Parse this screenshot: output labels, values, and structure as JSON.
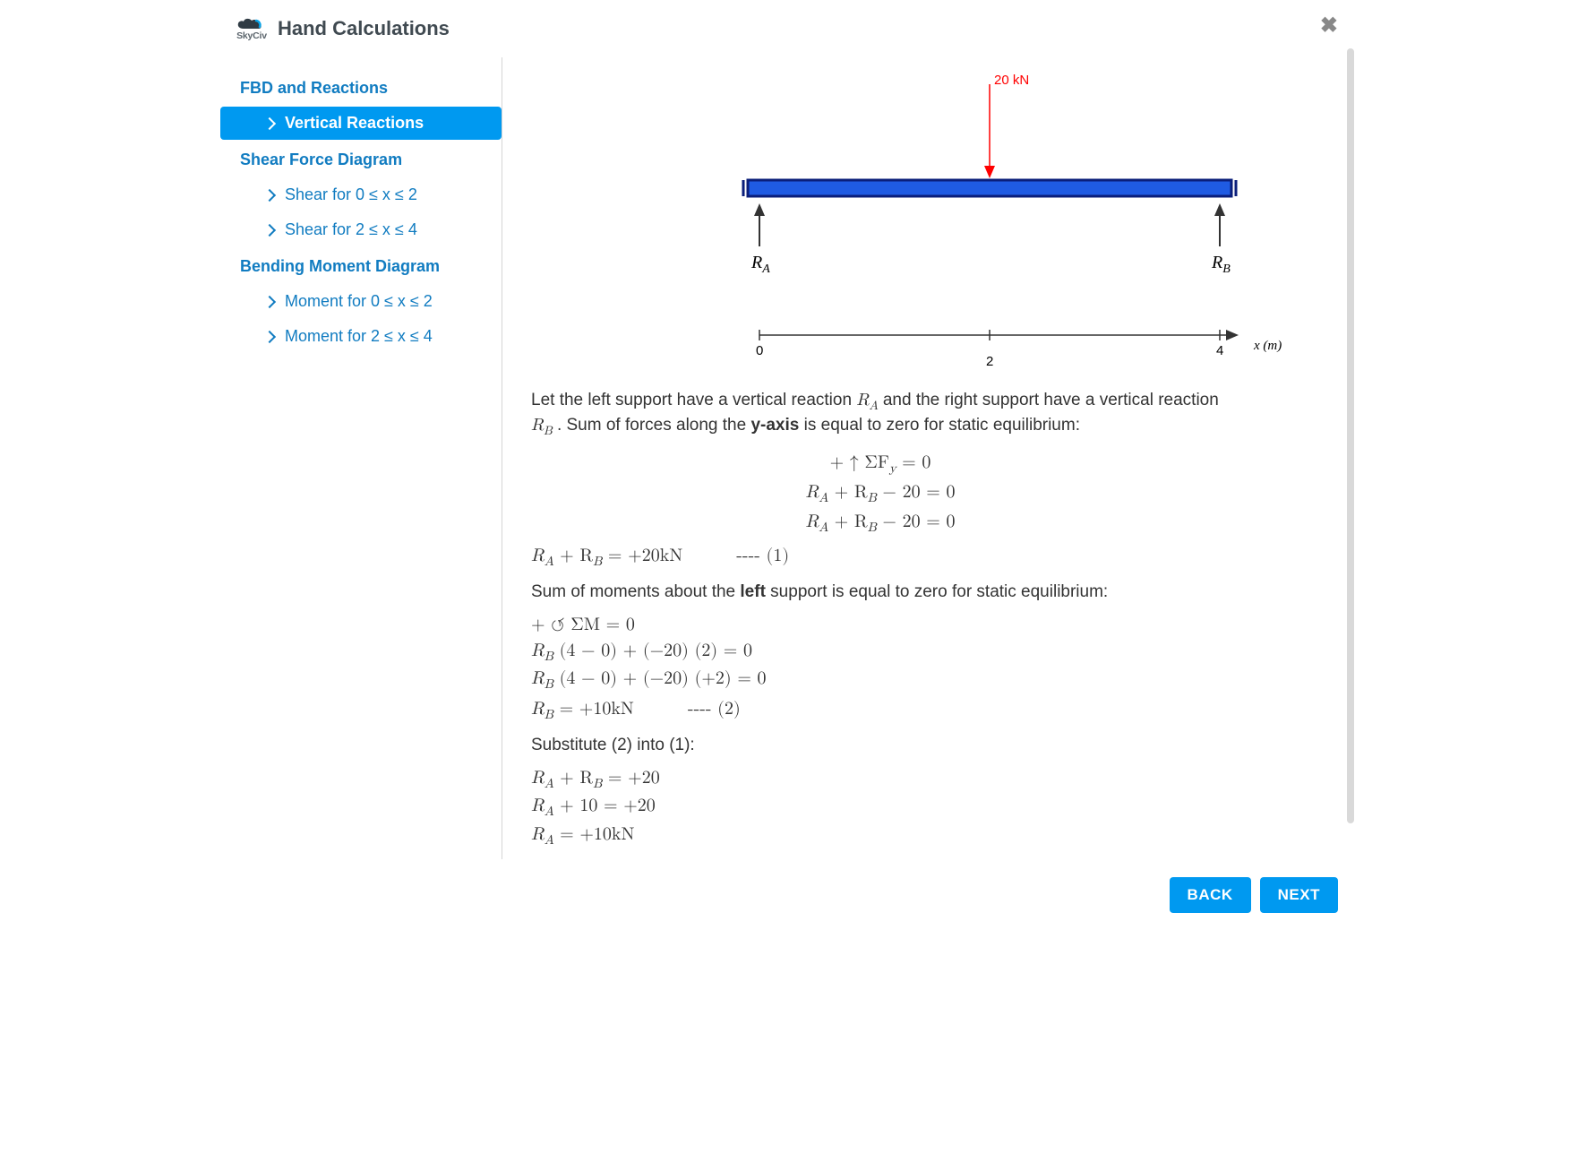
{
  "header": {
    "logo_text": "SkyCiv",
    "title": "Hand Calculations"
  },
  "sidebar": {
    "sections": [
      {
        "label": "FBD and Reactions",
        "items": [
          {
            "label": "Vertical Reactions",
            "active": true
          }
        ]
      },
      {
        "label": "Shear Force Diagram",
        "items": [
          {
            "label": "Shear for 0 ≤ x ≤ 2",
            "active": false
          },
          {
            "label": "Shear for 2 ≤ x ≤ 4",
            "active": false
          }
        ]
      },
      {
        "label": "Bending Moment Diagram",
        "items": [
          {
            "label": "Moment for 0 ≤ x ≤ 2",
            "active": false
          },
          {
            "label": "Moment for 2 ≤ x ≤ 4",
            "active": false
          }
        ]
      }
    ]
  },
  "diagram": {
    "load_label": "20 kN",
    "reaction_a": "R",
    "reaction_a_sub": "A",
    "reaction_b": "R",
    "reaction_b_sub": "B",
    "axis_label": "x (m)",
    "axis_values": [
      "0",
      "2",
      "4"
    ]
  },
  "content": {
    "para1_a": "Let the left support have a vertical reaction ",
    "para1_b": " and the right support have a vertical reaction ",
    "para1_c": " . Sum of forces along the ",
    "para1_d": "y-axis",
    "para1_e": " is equal to zero for static equilibrium:",
    "eq1": "+ ↑ ΣF",
    "eq1_sub": "y",
    "eq1_tail": " = 0",
    "eq2_a": "R",
    "eq2_b": " + R",
    "eq2_c": " − 20 = 0",
    "eq3_a": "R",
    "eq3_b": " + R",
    "eq3_c": " − 20 = 0",
    "eq4_a": "R",
    "eq4_b": " + R",
    "eq4_c": " = +20kN",
    "eq4_label": "---- (1)",
    "para2_a": "Sum of moments about the ",
    "para2_b": "left",
    "para2_c": " support is equal to zero for static equilibrium:",
    "eq5": "+ ↺ ΣM = 0",
    "eq6_a": "R",
    "eq6_b": " (4 − 0) + (−20) (2) = 0",
    "eq7_a": "R",
    "eq7_b": " (4 − 0) + (−20) (+2) = 0",
    "eq8_a": "R",
    "eq8_b": " = +10kN",
    "eq8_label": "---- (2)",
    "para3": "Substitute (2) into (1):",
    "eq9_a": "R",
    "eq9_b": " + R",
    "eq9_c": " = +20",
    "eq10_a": "R",
    "eq10_b": " + 10 = +20",
    "eq11_a": "R",
    "eq11_b": " = +10kN"
  },
  "footer": {
    "back": "BACK",
    "next": "NEXT"
  }
}
